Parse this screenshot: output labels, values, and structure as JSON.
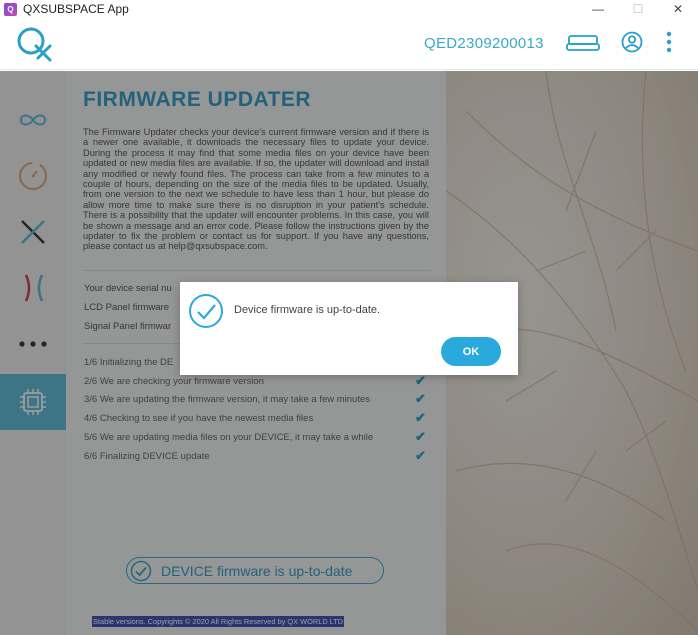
{
  "window": {
    "title": "QXSUBSPACE App",
    "app_icon_glyph": "Q",
    "minimize_glyph": "—",
    "maximize_glyph": "☐",
    "close_glyph": "✕"
  },
  "header": {
    "serial": "QED2309200013",
    "icons": [
      "device-icon",
      "user-icon",
      "more-vertical-icon"
    ],
    "logo": "qx-logo",
    "accent": "#3aa9c9"
  },
  "sidebar": {
    "items": [
      {
        "name": "infinity-icon",
        "active": false
      },
      {
        "name": "dial-icon",
        "active": false
      },
      {
        "name": "cross-icon",
        "active": false
      },
      {
        "name": "brackets-icon",
        "active": false
      },
      {
        "name": "more-horizontal-icon",
        "active": false
      },
      {
        "name": "chip-icon",
        "active": true
      }
    ]
  },
  "main": {
    "title": "FIRMWARE UPDATER",
    "description": "The Firmware Updater checks your device's current firmware version and if there is a newer one available, it downloads the necessary files to update your device. During the process it may find that some media files on your device have been updated or new media files are available. If so, the updater will download and install any modified or newly found files. The process can take from a few minutes to a couple of hours, depending on the size of the media files to be updated. Usually, from one version to the next we schedule to have less than 1 hour, but please do allow more time to make sure there is no disruption in your patient's schedule. There is a possibility that the updater will encounter problems. In this case, you will be shown a message and an error code. Please follow the instructions given by the updater to fix the problem or contact us for support. If you have any questions, please contact us at help@qxsubspace.com.",
    "info": [
      "Your device serial nu",
      "LCD Panel firmware",
      "Signal Panel firmwar"
    ],
    "steps": [
      {
        "label": "1/6  Initializing the DE",
        "done": false
      },
      {
        "label": "2/6  We are checking your firmware version",
        "done": true
      },
      {
        "label": "3/6  We are updating the firmware version, it may take a few minutes",
        "done": true
      },
      {
        "label": "4/6  Checking to see if you have the newest media files",
        "done": true
      },
      {
        "label": "5/6  We are updating media files on your DEVICE, it may take a while",
        "done": true
      },
      {
        "label": "6/6  Finalizing DEVICE update",
        "done": true
      }
    ],
    "status_text": "DEVICE firmware is up-to-date",
    "footer": "Stable versions. Copyrights © 2020 All Rights Reserved by QX WORLD LTD"
  },
  "dialog": {
    "message": "Device firmware is up-to-date.",
    "ok_label": "OK",
    "icon": "check-circle-icon",
    "button_color": "#2aaadc"
  }
}
